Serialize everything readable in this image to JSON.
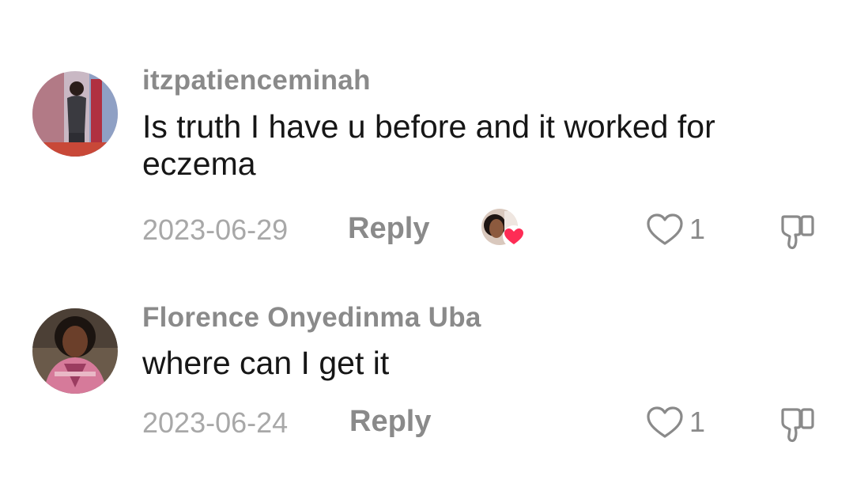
{
  "comments": [
    {
      "username": "itzpatienceminah",
      "text": "Is truth I have u before and it worked for eczema",
      "date": "2023-06-29",
      "reply_label": "Reply",
      "liked_by_creator": true,
      "like_count": "1"
    },
    {
      "username": "Florence Onyedinma Uba",
      "text": "where can I get it",
      "date": "2023-06-24",
      "reply_label": "Reply",
      "liked_by_creator": false,
      "like_count": "1"
    }
  ],
  "icons": {
    "like": "heart-outline-icon",
    "dislike": "thumbs-down-icon",
    "creator_like_badge": "heart-filled-icon"
  },
  "colors": {
    "username": "#8a8a8a",
    "text": "#161616",
    "date": "#a8a8a8",
    "heart_badge": "#fe2c55"
  }
}
